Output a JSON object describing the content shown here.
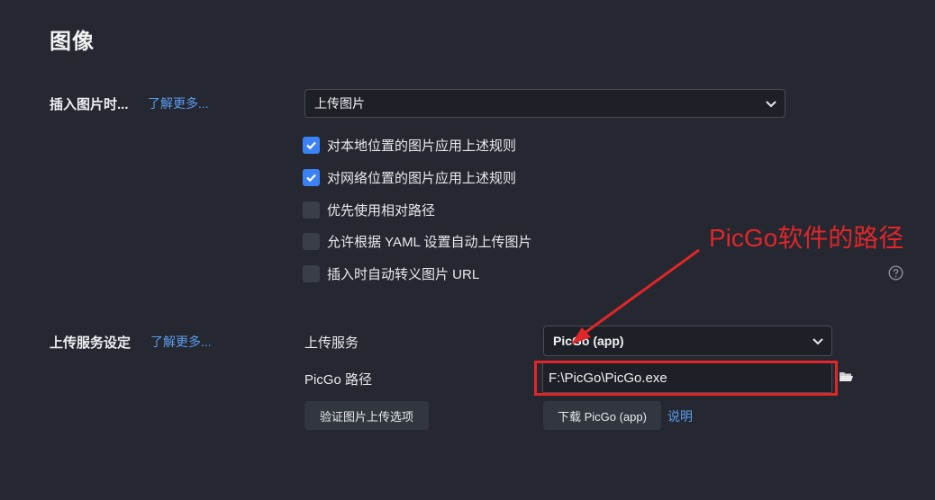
{
  "section": {
    "title": "图像"
  },
  "insert_image": {
    "label": "插入图片时...",
    "learn_more": "了解更多...",
    "select_value": "上传图片"
  },
  "checkboxes": [
    {
      "label": "对本地位置的图片应用上述规则",
      "checked": true
    },
    {
      "label": "对网络位置的图片应用上述规则",
      "checked": true
    },
    {
      "label": "优先使用相对路径",
      "checked": false
    },
    {
      "label": "允许根据 YAML 设置自动上传图片",
      "checked": false
    },
    {
      "label": "插入时自动转义图片 URL",
      "checked": false
    }
  ],
  "upload": {
    "label": "上传服务设定",
    "learn_more": "了解更多...",
    "service_label": "上传服务",
    "service_value": "PicGo (app)",
    "path_label": "PicGo 路径",
    "path_value": "F:\\PicGo\\PicGo.exe",
    "verify_button": "验证图片上传选项",
    "download_button": "下载 PicGo (app)",
    "help_link": "说明"
  },
  "annotation": {
    "text": "PicGo软件的路径",
    "color": "#e1262a"
  },
  "colors": {
    "background": "#252830",
    "accent": "#3b82f6",
    "link": "#5b9cf0"
  },
  "icons": [
    "chevron-down-icon",
    "question-circle-icon",
    "folder-icon",
    "checkmark-icon"
  ]
}
